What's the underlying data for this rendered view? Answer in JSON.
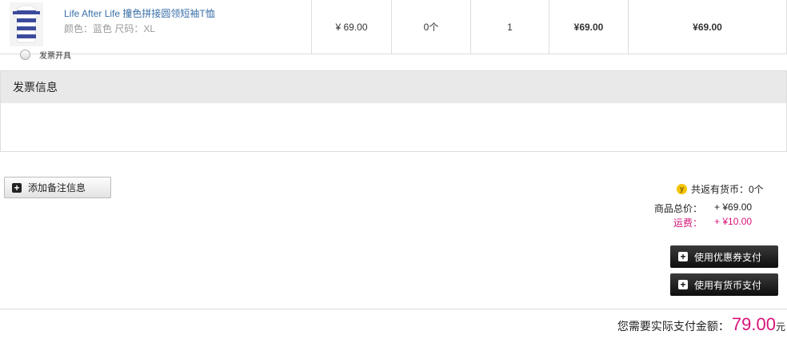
{
  "product": {
    "name": "Life After Life 撞色拼接圆领短袖T恤",
    "attributes": "颜色：蓝色 尺码：XL",
    "unit_price": "¥ 69.00",
    "coins": "0个",
    "quantity": "1",
    "subtotal": "¥69.00",
    "total": "¥69.00"
  },
  "invoice": {
    "title": "发票信息",
    "option_label": "发票开具"
  },
  "remark": {
    "button_label": "添加备注信息"
  },
  "summary": {
    "coin_icon_letter": "y",
    "coin_back": "共返有货币：0个",
    "goods_total_label": "商品总价：",
    "goods_total_value": "+ ¥69.00",
    "shipping_label": "运费：",
    "shipping_value": "+ ¥10.00",
    "coupon_button": "使用优惠券支付",
    "coins_button": "使用有货币支付"
  },
  "payment": {
    "label": "您需要实际支付金额：",
    "amount": "79.00",
    "unit": "元"
  },
  "colors": {
    "accent_pink": "#d6147a",
    "link_blue": "#3a6fa8",
    "coin_yellow": "#f5c400"
  }
}
